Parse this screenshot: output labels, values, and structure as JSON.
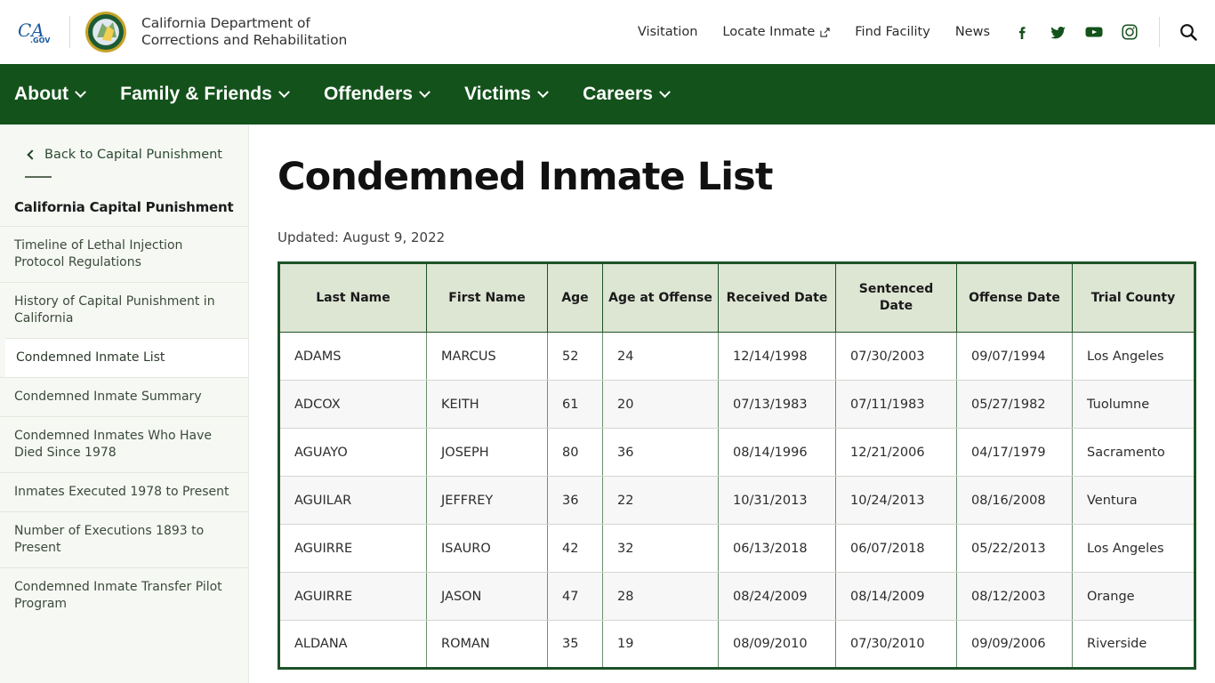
{
  "header": {
    "logo_name": "ca-gov-logo",
    "logo_text": "CA",
    "logo_sub": ".GOV",
    "seal_name": "cdcr-seal",
    "department_title": "California Department of Corrections and Rehabilitation",
    "nav_links": [
      {
        "label": "Visitation",
        "external": false
      },
      {
        "label": "Locate Inmate",
        "external": true
      },
      {
        "label": "Find Facility",
        "external": false
      },
      {
        "label": "News",
        "external": false
      }
    ],
    "social": [
      {
        "name": "facebook-icon",
        "label": "Facebook"
      },
      {
        "name": "twitter-icon",
        "label": "Twitter"
      },
      {
        "name": "youtube-icon",
        "label": "YouTube"
      },
      {
        "name": "instagram-icon",
        "label": "Instagram"
      }
    ],
    "search_label": "Search"
  },
  "main_nav": {
    "items": [
      {
        "label": "About"
      },
      {
        "label": "Family & Friends"
      },
      {
        "label": "Offenders"
      },
      {
        "label": "Victims"
      },
      {
        "label": "Careers"
      }
    ]
  },
  "sidebar": {
    "back_label": "Back to Capital Punishment",
    "heading": "California Capital Punishment",
    "items": [
      {
        "label": "Timeline of Lethal Injection Protocol Regulations",
        "active": false
      },
      {
        "label": "History of Capital Punishment in California",
        "active": false
      },
      {
        "label": "Condemned Inmate List",
        "active": true
      },
      {
        "label": "Condemned Inmate Summary",
        "active": false
      },
      {
        "label": "Condemned Inmates Who Have Died Since 1978",
        "active": false
      },
      {
        "label": "Inmates Executed 1978 to Present",
        "active": false
      },
      {
        "label": "Number of Executions 1893 to Present",
        "active": false
      },
      {
        "label": "Condemned Inmate Transfer Pilot Program",
        "active": false
      }
    ]
  },
  "main": {
    "title": "Condemned Inmate List",
    "updated": "Updated: August 9, 2022"
  },
  "table": {
    "columns": [
      {
        "label": "Last Name",
        "key": "last_name",
        "class": "col-last"
      },
      {
        "label": "First Name",
        "key": "first_name",
        "class": "col-first"
      },
      {
        "label": "Age",
        "key": "age",
        "class": "col-age"
      },
      {
        "label": "Age at Offense",
        "key": "age_at_offense",
        "class": "col-ageoff"
      },
      {
        "label": "Received Date",
        "key": "received_date",
        "class": "col-rec"
      },
      {
        "label": "Sentenced Date",
        "key": "sentenced_date",
        "class": "col-sent"
      },
      {
        "label": "Offense Date",
        "key": "offense_date",
        "class": "col-off"
      },
      {
        "label": "Trial County",
        "key": "trial_county",
        "class": "col-county"
      }
    ],
    "rows": [
      {
        "last_name": "ADAMS",
        "first_name": "MARCUS",
        "age": "52",
        "age_at_offense": "24",
        "received_date": "12/14/1998",
        "sentenced_date": "07/30/2003",
        "offense_date": "09/07/1994",
        "trial_county": "Los Angeles"
      },
      {
        "last_name": "ADCOX",
        "first_name": "KEITH",
        "age": "61",
        "age_at_offense": "20",
        "received_date": "07/13/1983",
        "sentenced_date": "07/11/1983",
        "offense_date": "05/27/1982",
        "trial_county": "Tuolumne"
      },
      {
        "last_name": "AGUAYO",
        "first_name": "JOSEPH",
        "age": "80",
        "age_at_offense": "36",
        "received_date": "08/14/1996",
        "sentenced_date": "12/21/2006",
        "offense_date": "04/17/1979",
        "trial_county": "Sacramento"
      },
      {
        "last_name": "AGUILAR",
        "first_name": "JEFFREY",
        "age": "36",
        "age_at_offense": "22",
        "received_date": "10/31/2013",
        "sentenced_date": "10/24/2013",
        "offense_date": "08/16/2008",
        "trial_county": "Ventura"
      },
      {
        "last_name": "AGUIRRE",
        "first_name": "ISAURO",
        "age": "42",
        "age_at_offense": "32",
        "received_date": "06/13/2018",
        "sentenced_date": "06/07/2018",
        "offense_date": "05/22/2013",
        "trial_county": "Los Angeles"
      },
      {
        "last_name": "AGUIRRE",
        "first_name": "JASON",
        "age": "47",
        "age_at_offense": "28",
        "received_date": "08/24/2009",
        "sentenced_date": "08/14/2009",
        "offense_date": "08/12/2003",
        "trial_county": "Orange"
      },
      {
        "last_name": "ALDANA",
        "first_name": "ROMAN",
        "age": "35",
        "age_at_offense": "19",
        "received_date": "08/09/2010",
        "sentenced_date": "07/30/2010",
        "offense_date": "09/09/2006",
        "trial_county": "Riverside"
      }
    ]
  },
  "colors": {
    "nav_green": "#14521c",
    "table_border": "#1d5228",
    "table_header_bg": "#dde5d3",
    "sidebar_bg": "#f6f8f4",
    "row_alt_bg": "#f7f7f7"
  }
}
